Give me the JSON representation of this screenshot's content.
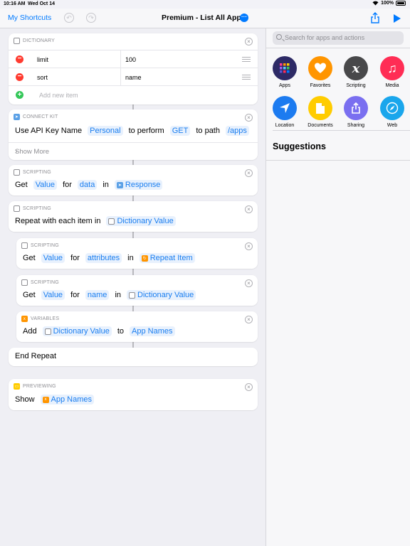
{
  "status": {
    "time": "10:16 AM",
    "date": "Wed Oct 14",
    "battery": "100%"
  },
  "nav": {
    "back_label": "My Shortcuts",
    "title": "Premium - List All Apps"
  },
  "actions": {
    "dictionary": {
      "header": "DICTIONARY",
      "rows": [
        {
          "key": "limit",
          "value": "100"
        },
        {
          "key": "sort",
          "value": "name"
        }
      ],
      "add_label": "Add new item"
    },
    "connect_kit": {
      "header": "CONNECT KIT",
      "w1": "Use API Key Name",
      "t1": "Personal",
      "w2": "to perform",
      "t2": "GET",
      "w3": "to path",
      "t3": "/apps",
      "show_more": "Show More"
    },
    "get1": {
      "header": "SCRIPTING",
      "w1": "Get",
      "t1": "Value",
      "w2": "for",
      "t2": "data",
      "w3": "in",
      "t3": "Response"
    },
    "repeat": {
      "header": "SCRIPTING",
      "w1": "Repeat with each item in",
      "t1": "Dictionary Value"
    },
    "get2": {
      "header": "SCRIPTING",
      "w1": "Get",
      "t1": "Value",
      "w2": "for",
      "t2": "attributes",
      "w3": "in",
      "t3": "Repeat Item"
    },
    "get3": {
      "header": "SCRIPTING",
      "w1": "Get",
      "t1": "Value",
      "w2": "for",
      "t2": "name",
      "w3": "in",
      "t3": "Dictionary Value"
    },
    "add": {
      "header": "VARIABLES",
      "w1": "Add",
      "t1": "Dictionary Value",
      "w2": "to",
      "t2": "App Names"
    },
    "end_repeat": {
      "label": "End Repeat"
    },
    "show": {
      "header": "PREVIEWING",
      "w1": "Show",
      "t1": "App Names"
    }
  },
  "sidebar": {
    "search_placeholder": "Search for apps and actions",
    "categories": [
      {
        "label": "Apps",
        "color": "#2d2a66",
        "icon": "apps-grid-icon"
      },
      {
        "label": "Favorites",
        "color": "#ff9500",
        "icon": "heart-icon"
      },
      {
        "label": "Scripting",
        "color": "#48484a",
        "icon": "scripting-x-icon"
      },
      {
        "label": "Media",
        "color": "#ff2d55",
        "icon": "music-note-icon"
      },
      {
        "label": "Location",
        "color": "#1c7bf0",
        "icon": "location-arrow-icon"
      },
      {
        "label": "Documents",
        "color": "#ffcc00",
        "icon": "document-icon"
      },
      {
        "label": "Sharing",
        "color": "#7a6ff0",
        "icon": "share-icon"
      },
      {
        "label": "Web",
        "color": "#1aa6ec",
        "icon": "compass-icon"
      }
    ],
    "suggestions_title": "Suggestions"
  }
}
